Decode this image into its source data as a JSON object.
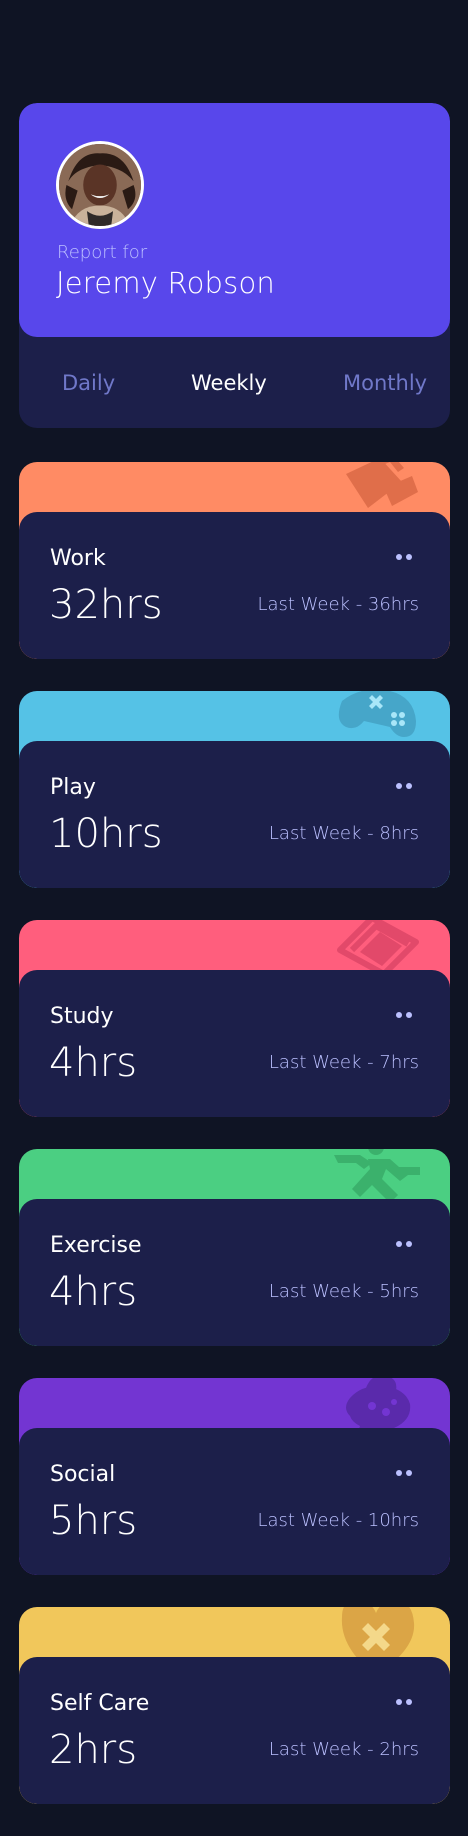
{
  "profile": {
    "report_for": "Report for",
    "name": "Jeremy Robson",
    "avatar_icon": "person-photo"
  },
  "tabs": [
    {
      "label": "Daily",
      "active": false
    },
    {
      "label": "Weekly",
      "active": true
    },
    {
      "label": "Monthly",
      "active": false
    }
  ],
  "activities": [
    {
      "title": "Work",
      "hours": "32hrs",
      "last": "Last Week - 36hrs",
      "color": "#ff8b64",
      "icon": "briefcase-icon"
    },
    {
      "title": "Play",
      "hours": "10hrs",
      "last": "Last Week - 8hrs",
      "color": "#55c2e6",
      "icon": "gamepad-icon"
    },
    {
      "title": "Study",
      "hours": "4hrs",
      "last": "Last Week - 7hrs",
      "color": "#ff5e7d",
      "icon": "book-icon"
    },
    {
      "title": "Exercise",
      "hours": "4hrs",
      "last": "Last Week - 5hrs",
      "color": "#4bcf82",
      "icon": "running-icon"
    },
    {
      "title": "Social",
      "hours": "5hrs",
      "last": "Last Week - 10hrs",
      "color": "#7335d2",
      "icon": "chat-icon"
    },
    {
      "title": "Self Care",
      "hours": "2hrs",
      "last": "Last Week - 2hrs",
      "color": "#f1c75b",
      "icon": "heart-icon"
    }
  ],
  "colors": {
    "background": "#0f1424",
    "card": "#1c1f4a",
    "profile_accent": "#5847eb",
    "muted_text": "#bbc0ff",
    "tab_inactive": "#7078c9"
  }
}
